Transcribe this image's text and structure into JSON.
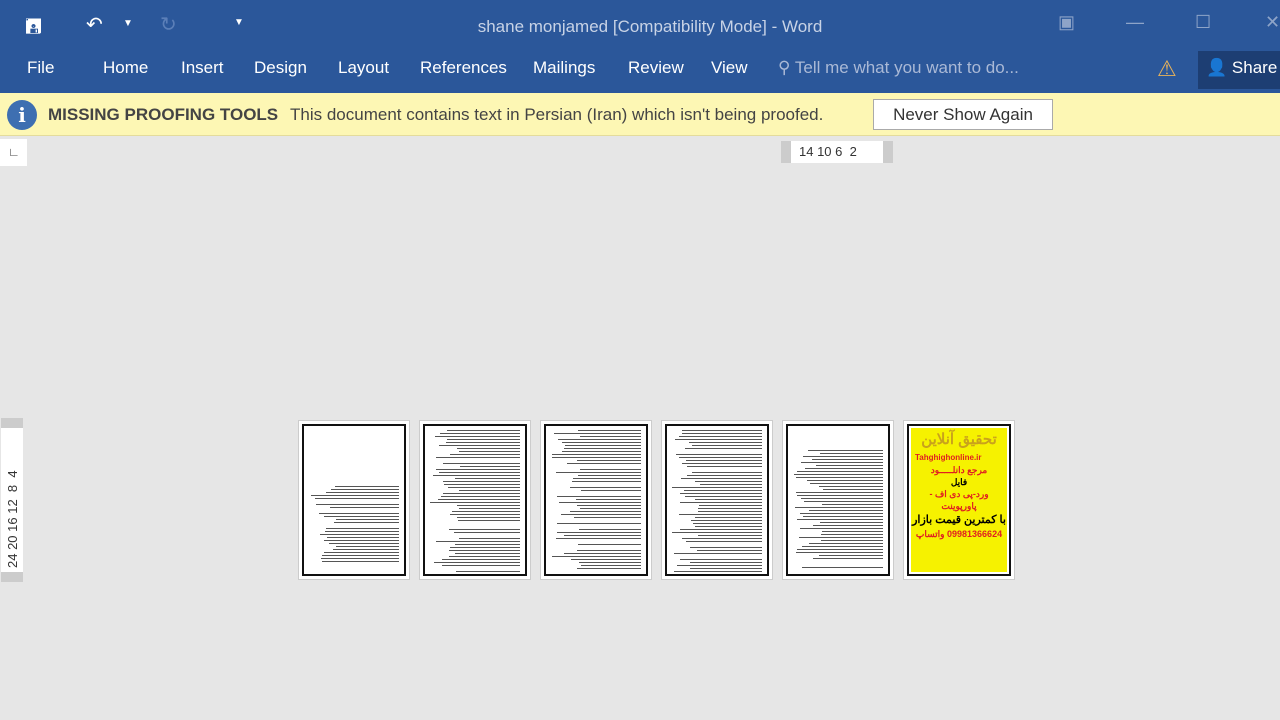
{
  "window": {
    "title": "shane monjamed [Compatibility Mode] - Word"
  },
  "quick_access": {
    "save": "save-icon",
    "undo": "undo-icon",
    "redo": "redo-icon",
    "customize": "customize-icon"
  },
  "ribbon": {
    "tabs": [
      "File",
      "Home",
      "Insert",
      "Design",
      "Layout",
      "References",
      "Mailings",
      "Review",
      "View"
    ],
    "tell_me": "Tell me what you want to do...",
    "share": "Share"
  },
  "message_bar": {
    "title": "MISSING PROOFING TOOLS",
    "message": "This document contains text in Persian (Iran) which isn't being proofed.",
    "button": "Never Show Again"
  },
  "rulers": {
    "horizontal": "14 10 6  2",
    "vertical": "24 20 16 12  8  4"
  },
  "ad_page": {
    "title": "تحقیق آنلاین",
    "site": "Tahghighonline.ir",
    "l1": "مرجع دانلـــــود",
    "l2": "فایل",
    "l3": "ورد-پی دی اف - پاورپوینت",
    "l4": "با کمترین قیمت بازار",
    "l5": "09981366624 واتساپ"
  },
  "colors": {
    "ribbon": "#2b579a",
    "message_bar": "#fdf7b4",
    "ad_bg": "#f6f200"
  }
}
